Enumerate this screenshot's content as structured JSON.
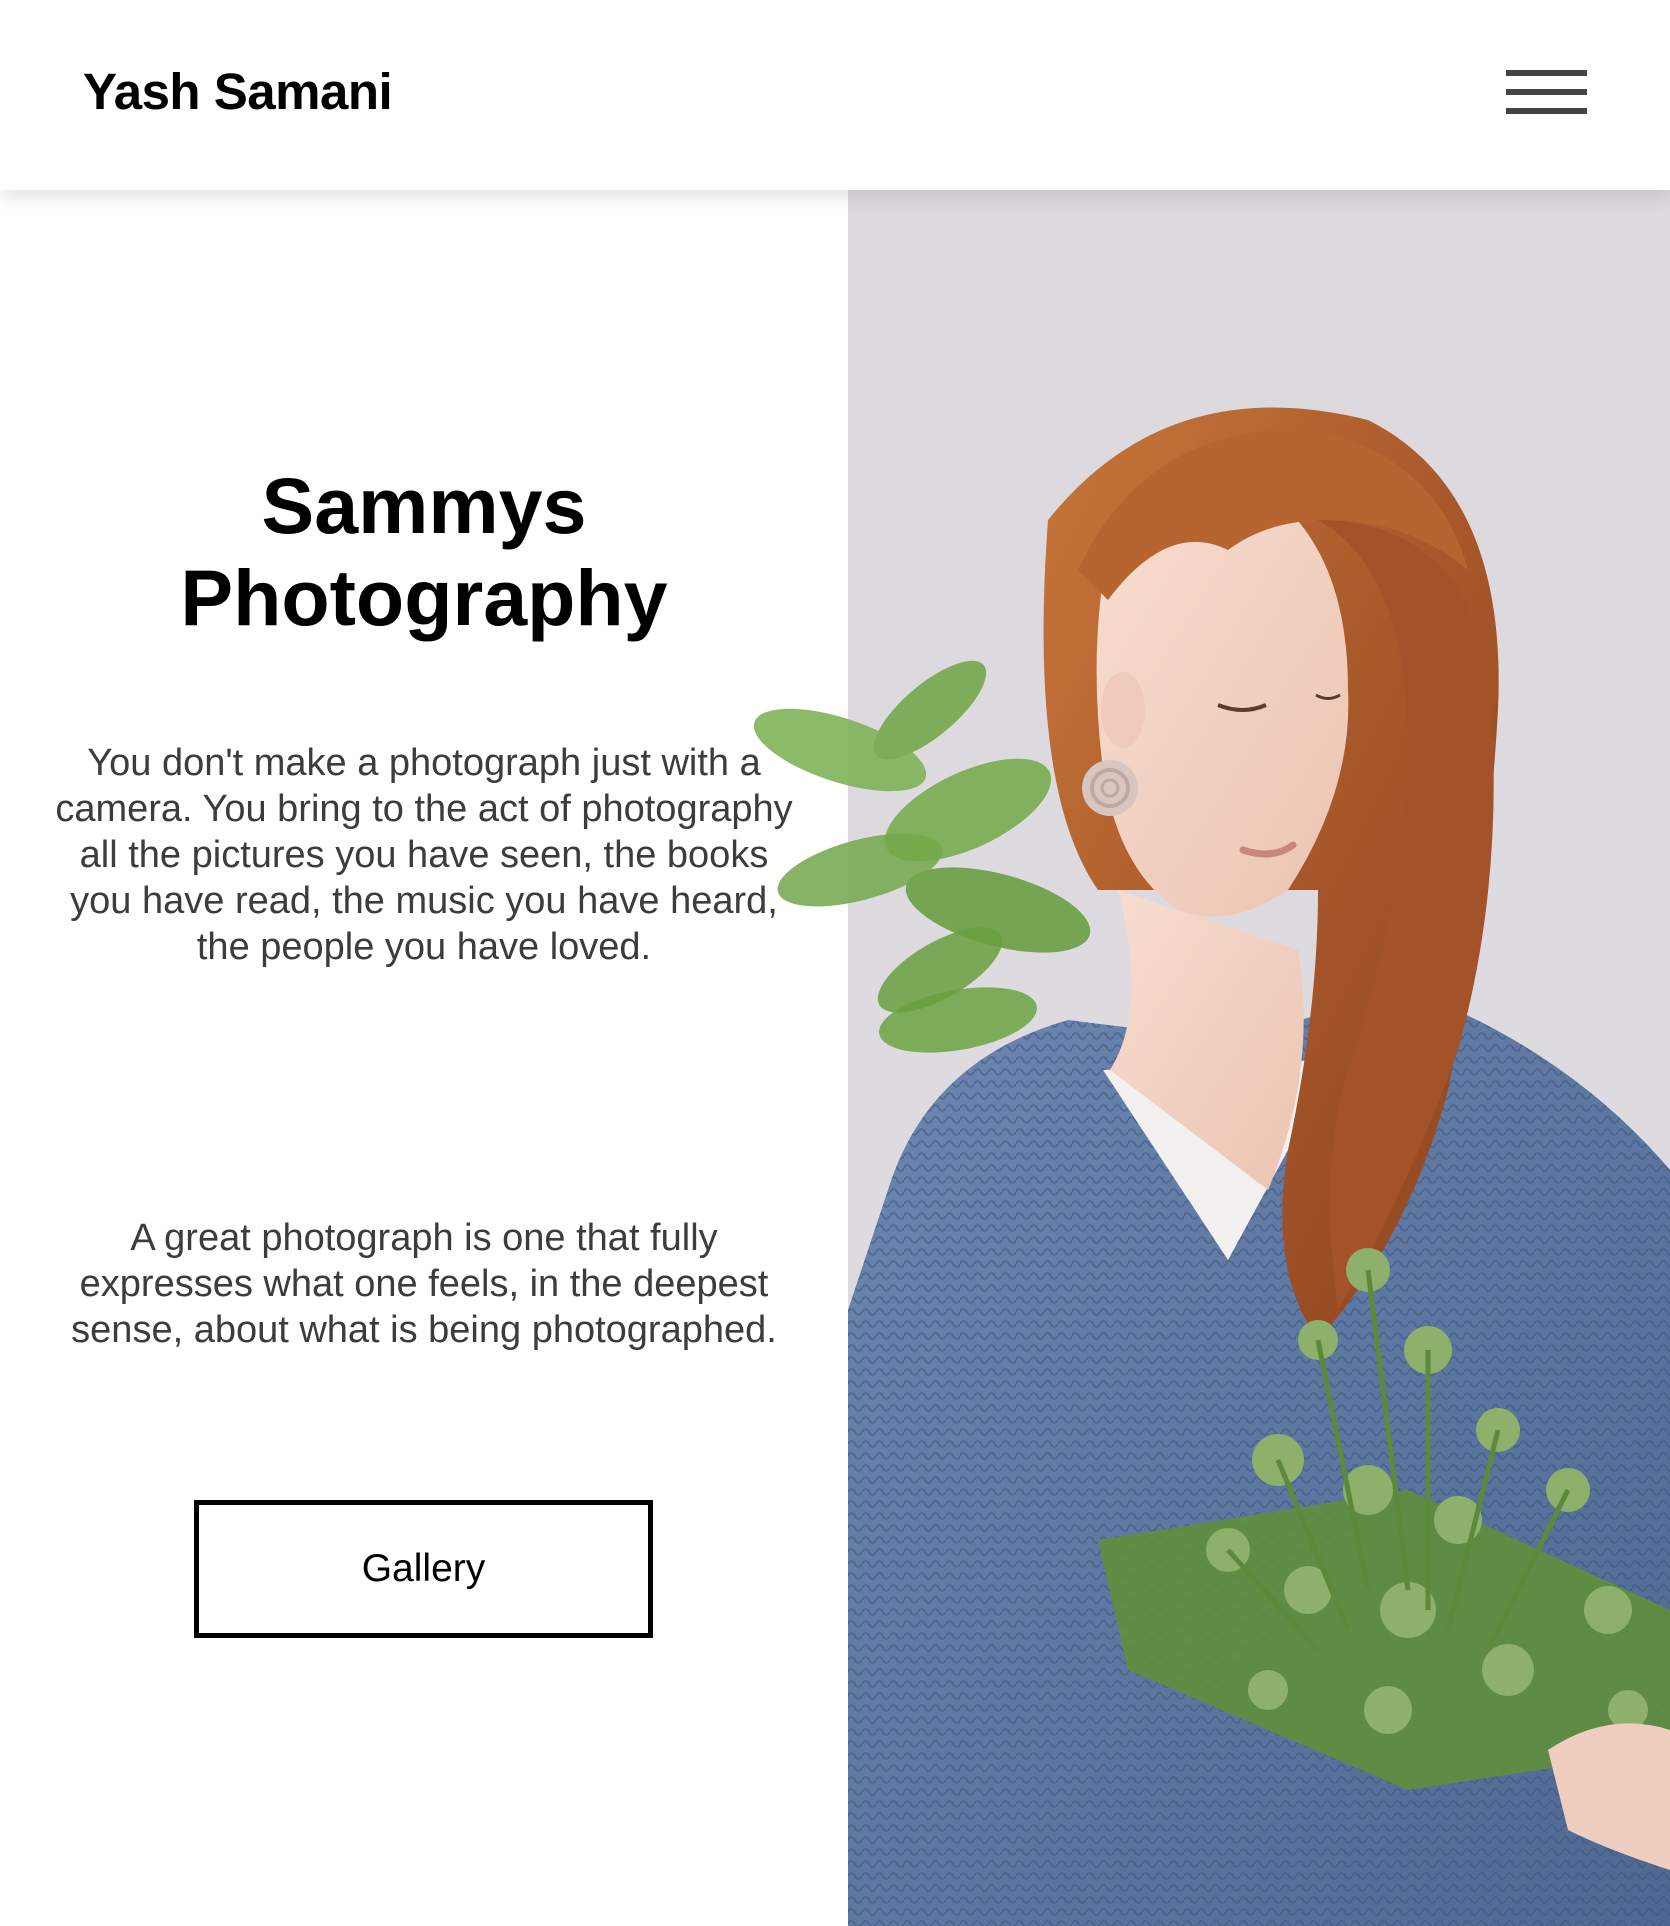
{
  "header": {
    "brand": "Yash Samani",
    "menu_icon": "hamburger-menu-icon"
  },
  "hero": {
    "title_line1": "Sammys",
    "title_line2": "Photography",
    "quote1": "You don't make a photograph just with a camera. You bring to the act of photography all the pictures you have seen, the books you have read, the music you have heard, the people you have loved.",
    "quote2": "A great photograph is one that fully expresses what one feels, in the deepest sense, about what is being photographed.",
    "gallery_label": "Gallery"
  },
  "colors": {
    "background": "#ffffff",
    "text_primary": "#000000",
    "text_body": "#3c3c3c",
    "photo_backdrop": "#dcdade",
    "sweater_blue": "#5c78a3",
    "hair": "#b4622c",
    "plant_green": "#6fa444"
  }
}
